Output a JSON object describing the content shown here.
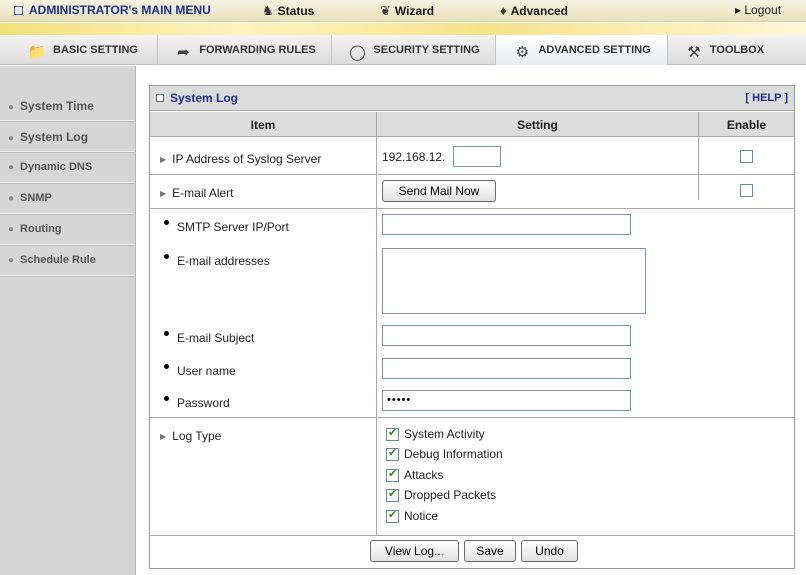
{
  "topbar": {
    "menu_label": "ADMINISTRATOR's MAIN MENU",
    "status_label": "Status",
    "wizard_label": "Wizard",
    "advanced_label": "Advanced",
    "logout_label": "▸ Logout"
  },
  "tabs": [
    {
      "label": "BASIC SETTING",
      "icon": "folder-icon"
    },
    {
      "label": "FORWARDING RULES",
      "icon": "arrow-icon"
    },
    {
      "label": "SECURITY SETTING",
      "icon": "lock-icon"
    },
    {
      "label": "ADVANCED SETTING",
      "icon": "gear-icon",
      "active": true
    },
    {
      "label": "TOOLBOX",
      "icon": "toolbox-icon"
    }
  ],
  "sidebar": {
    "items": [
      {
        "label": "System Time"
      },
      {
        "label": "System Log"
      },
      {
        "label": "Dynamic DNS"
      },
      {
        "label": "SNMP"
      },
      {
        "label": "Routing"
      },
      {
        "label": "Schedule Rule"
      }
    ]
  },
  "panel": {
    "title": "System Log",
    "help": "[ HELP ]",
    "headers": {
      "item": "Item",
      "setting": "Setting",
      "enable": "Enable"
    }
  },
  "rows": {
    "syslog_label": "IP Address of Syslog Server",
    "syslog_prefix": "192.168.12.",
    "syslog_value": "",
    "syslog_enabled": false,
    "email_alert_label": "E-mail Alert",
    "send_mail_button": "Send Mail Now",
    "email_alert_enabled": false,
    "smtp_label": "SMTP Server IP/Port",
    "smtp_value": "",
    "addresses_label": "E-mail addresses",
    "addresses_value": "",
    "subject_label": "E-mail Subject",
    "subject_value": "",
    "username_label": "User name",
    "username_value": "",
    "password_label": "Password",
    "password_value": "•••••",
    "logtype_label": "Log Type"
  },
  "log_types": [
    {
      "label": "System Activity",
      "checked": true
    },
    {
      "label": "Debug Information",
      "checked": true
    },
    {
      "label": "Attacks",
      "checked": true
    },
    {
      "label": "Dropped Packets",
      "checked": true
    },
    {
      "label": "Notice",
      "checked": true
    }
  ],
  "buttons": {
    "view_log": "View Log...",
    "save": "Save",
    "undo": "Undo"
  }
}
